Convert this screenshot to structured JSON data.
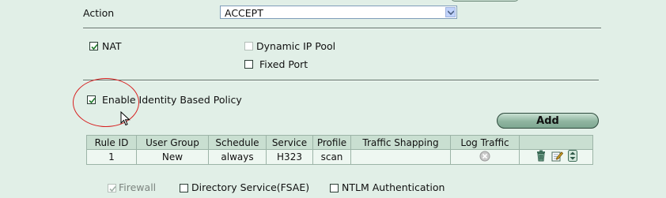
{
  "action": {
    "label": "Action",
    "value": "ACCEPT"
  },
  "nat": {
    "label": "NAT",
    "checked": true
  },
  "dynamic_ip_pool": {
    "label": "Dynamic IP Pool",
    "checked": false,
    "disabled": true
  },
  "fixed_port": {
    "label": "Fixed Port",
    "checked": false
  },
  "identity_policy": {
    "label": "Enable Identity Based Policy",
    "checked": true
  },
  "add_button": {
    "label": "Add"
  },
  "table": {
    "columns": [
      "Rule ID",
      "User Group",
      "Schedule",
      "Service",
      "Profile",
      "Traffic Shapping",
      "Log Traffic"
    ],
    "rows": [
      {
        "rule_id": "1",
        "user_group": "New",
        "schedule": "always",
        "service": "H323",
        "profile": "scan",
        "traffic_shaping": "",
        "log_traffic": "disabled-icon"
      }
    ]
  },
  "auth": {
    "firewall": {
      "label": "Firewall",
      "checked": true,
      "disabled": true
    },
    "fsae": {
      "label": "Directory Service(FSAE)",
      "checked": false
    },
    "ntlm": {
      "label": "NTLM Authentication",
      "checked": false
    }
  },
  "colors": {
    "background": "#e1efe7",
    "header": "#c9dfd1",
    "highlight_circle": "#d72020"
  }
}
